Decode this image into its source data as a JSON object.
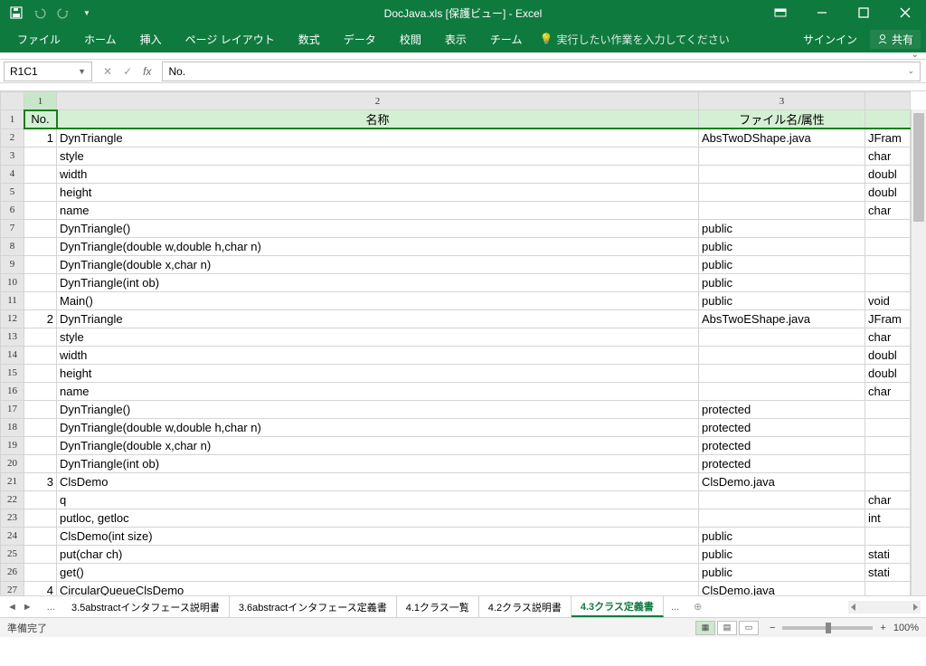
{
  "titlebar": {
    "title": "DocJava.xls  [保護ビュー] - Excel"
  },
  "ribbon": {
    "tabs": [
      "ファイル",
      "ホーム",
      "挿入",
      "ページ レイアウト",
      "数式",
      "データ",
      "校閲",
      "表示",
      "チーム"
    ],
    "tellme": "実行したい作業を入力してください",
    "signin": "サインイン",
    "share": "共有"
  },
  "namebox": {
    "ref": "R1C1"
  },
  "formula": {
    "value": "No."
  },
  "columns": {
    "headers": [
      "1",
      "2",
      "3"
    ]
  },
  "gridHeaders": {
    "c1": "No.",
    "c2": "名称",
    "c3": "ファイル名/属性"
  },
  "rows": [
    {
      "r": "1",
      "no": "",
      "c2": "",
      "c3": "",
      "c4": "",
      "hdr": true
    },
    {
      "r": "2",
      "no": "1",
      "c2": "DynTriangle",
      "c3": "AbsTwoDShape.java",
      "c4": "JFram",
      "sep": true
    },
    {
      "r": "3",
      "no": "",
      "c2": "style",
      "c3": "",
      "c4": "char"
    },
    {
      "r": "4",
      "no": "",
      "c2": "width",
      "c3": "",
      "c4": "doubl"
    },
    {
      "r": "5",
      "no": "",
      "c2": "height",
      "c3": "",
      "c4": "doubl"
    },
    {
      "r": "6",
      "no": "",
      "c2": "name",
      "c3": "",
      "c4": "char"
    },
    {
      "r": "7",
      "no": "",
      "c2": "DynTriangle()",
      "c3": "public",
      "c4": ""
    },
    {
      "r": "8",
      "no": "",
      "c2": "DynTriangle(double w,double h,char n)",
      "c3": "public",
      "c4": ""
    },
    {
      "r": "9",
      "no": "",
      "c2": "DynTriangle(double x,char n)",
      "c3": "public",
      "c4": ""
    },
    {
      "r": "10",
      "no": "",
      "c2": "DynTriangle(int ob)",
      "c3": "public",
      "c4": ""
    },
    {
      "r": "11",
      "no": "",
      "c2": "Main()",
      "c3": "public",
      "c4": "void"
    },
    {
      "r": "12",
      "no": "2",
      "c2": "DynTriangle",
      "c3": "AbsTwoEShape.java",
      "c4": "JFram",
      "sep": true
    },
    {
      "r": "13",
      "no": "",
      "c2": "style",
      "c3": "",
      "c4": "char"
    },
    {
      "r": "14",
      "no": "",
      "c2": "width",
      "c3": "",
      "c4": "doubl"
    },
    {
      "r": "15",
      "no": "",
      "c2": "height",
      "c3": "",
      "c4": "doubl"
    },
    {
      "r": "16",
      "no": "",
      "c2": "name",
      "c3": "",
      "c4": "char"
    },
    {
      "r": "17",
      "no": "",
      "c2": "DynTriangle()",
      "c3": "protected",
      "c4": ""
    },
    {
      "r": "18",
      "no": "",
      "c2": "DynTriangle(double w,double h,char n)",
      "c3": "protected",
      "c4": ""
    },
    {
      "r": "19",
      "no": "",
      "c2": "DynTriangle(double x,char n)",
      "c3": "protected",
      "c4": ""
    },
    {
      "r": "20",
      "no": "",
      "c2": "DynTriangle(int ob)",
      "c3": "protected",
      "c4": ""
    },
    {
      "r": "21",
      "no": "3",
      "c2": "ClsDemo",
      "c3": "ClsDemo.java",
      "c4": "",
      "sep": true
    },
    {
      "r": "22",
      "no": "",
      "c2": "q",
      "c3": "",
      "c4": "char"
    },
    {
      "r": "23",
      "no": "",
      "c2": "putloc, getloc",
      "c3": "",
      "c4": "int"
    },
    {
      "r": "24",
      "no": "",
      "c2": "ClsDemo(int size)",
      "c3": "public",
      "c4": ""
    },
    {
      "r": "25",
      "no": "",
      "c2": "put(char ch)",
      "c3": "public",
      "c4": "stati"
    },
    {
      "r": "26",
      "no": "",
      "c2": "get()",
      "c3": "public",
      "c4": "stati"
    },
    {
      "r": "27",
      "no": "4",
      "c2": "CircularQueueClsDemo",
      "c3": "ClsDemo.java",
      "c4": "",
      "sep": true
    }
  ],
  "sheets": {
    "tabs": [
      "3.5abstractインタフェース説明書",
      "3.6abstractインタフェース定義書",
      "4.1クラス一覧",
      "4.2クラス説明書",
      "4.3クラス定義書"
    ],
    "active": 4
  },
  "status": {
    "ready": "準備完了",
    "zoom": "100%"
  }
}
